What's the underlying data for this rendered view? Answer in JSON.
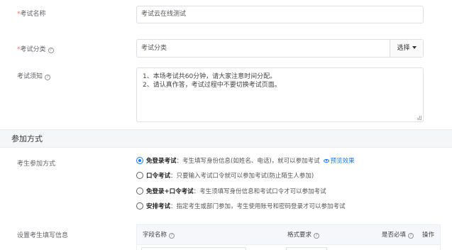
{
  "form": {
    "exam_name": {
      "label": "考试名称",
      "value": "考试云在线测试"
    },
    "exam_category": {
      "label": "考试分类",
      "value": "考试分类",
      "select_btn": "选择"
    },
    "exam_notice": {
      "label": "考试须知",
      "lines": [
        "1、本场考试共60分钟，请大家注意时间分配。",
        "2、请认真作答，考试过程中不要切换考试页面。"
      ]
    }
  },
  "section": {
    "title": "参加方式"
  },
  "join_method": {
    "label": "考生参加方式",
    "selected_index": 0,
    "options": [
      {
        "name": "免登录考试",
        "desc": "：考生填写身份信息(如姓名、电话)，就可以参加考试",
        "preview": "预览效果"
      },
      {
        "name": "口令考试",
        "desc": "：只要输入考试口令就可以参加考试(防止陌生人参加)"
      },
      {
        "name": "免登录+口令考试",
        "desc": "：考生须填写身份信息和考试口令才可以参加考试"
      },
      {
        "name": "安排考试",
        "desc": "：指定考生或部门参加，考生使用账号和密码登录才可以参加考试"
      }
    ]
  },
  "candidate_info": {
    "label": "设置考生填写信息",
    "columns": [
      "字段名称",
      "格式要求",
      "是否必填",
      "操作"
    ]
  },
  "colors": {
    "accent": "#1677ff",
    "required": "#f56c6c",
    "section_bg": "#f5f6f8"
  },
  "icons": {
    "help": "question-circle-icon",
    "caret": "caret-down-icon",
    "preview": "eye-icon"
  }
}
